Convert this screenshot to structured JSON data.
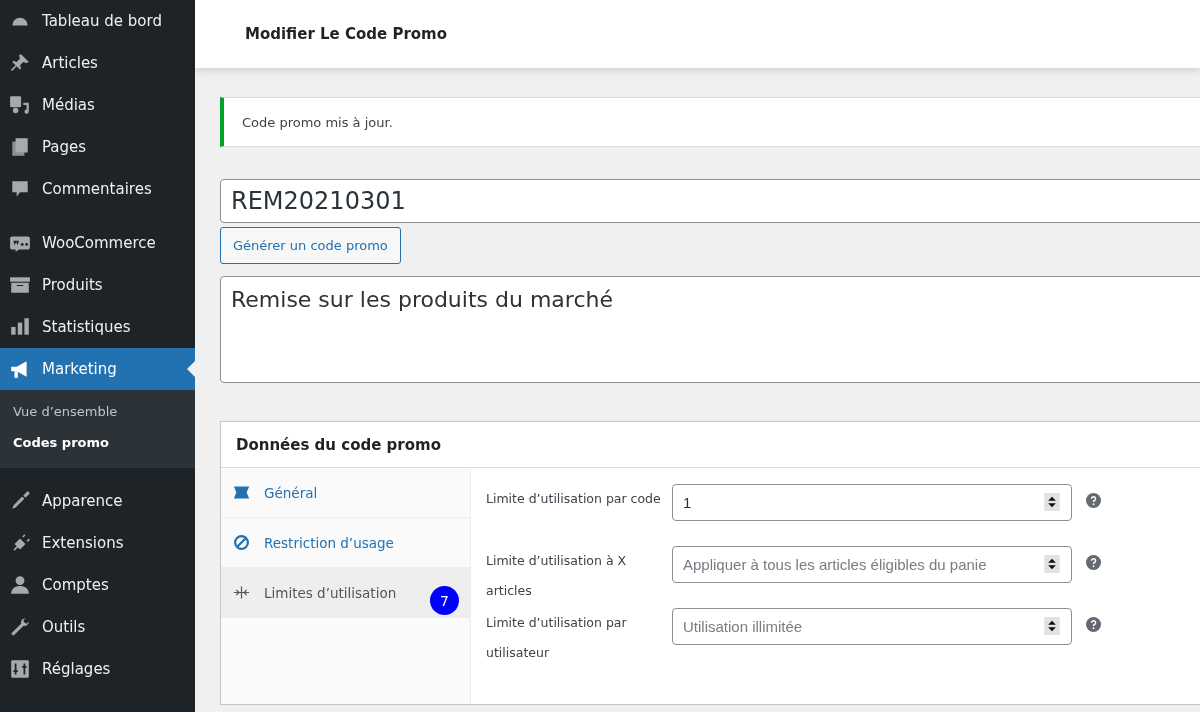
{
  "sidebar": {
    "items": [
      {
        "label": "Tableau de bord",
        "selected": false
      },
      {
        "label": "Articles",
        "selected": false
      },
      {
        "label": "Médias",
        "selected": false
      },
      {
        "label": "Pages",
        "selected": false
      },
      {
        "label": "Commentaires",
        "selected": false
      },
      {
        "label": "WooCommerce",
        "selected": false
      },
      {
        "label": "Produits",
        "selected": false
      },
      {
        "label": "Statistiques",
        "selected": false
      },
      {
        "label": "Marketing",
        "selected": true,
        "children": [
          {
            "label": "Vue d’ensemble",
            "selected": false
          },
          {
            "label": "Codes promo",
            "selected": true
          }
        ]
      },
      {
        "label": "Apparence",
        "selected": false
      },
      {
        "label": "Extensions",
        "selected": false
      },
      {
        "label": "Comptes",
        "selected": false
      },
      {
        "label": "Outils",
        "selected": false
      },
      {
        "label": "Réglages",
        "selected": false
      }
    ]
  },
  "header": {
    "title": "Modifier Le Code Promo"
  },
  "notice": {
    "text": "Code promo mis à jour."
  },
  "coupon_code": {
    "value": "REM20210301"
  },
  "generate_button": "Générer un code promo",
  "description": {
    "value": "Remise sur les produits du marché"
  },
  "coupon_data": {
    "title": "Données du code promo",
    "tabs": [
      {
        "label": "Général",
        "selected": false
      },
      {
        "label": "Restriction d’usage",
        "selected": false
      },
      {
        "label": "Limites d’utilisation",
        "selected": true,
        "badge": "7"
      }
    ],
    "fields": [
      {
        "label": "Limite d’utilisation par code",
        "value": "1"
      },
      {
        "label": "Limite d’utilisation à X articles",
        "placeholder": "Appliquer à tous les articles éligibles du panie"
      },
      {
        "label": "Limite d’utilisation par utilisateur",
        "placeholder": "Utilisation illimitée"
      }
    ]
  }
}
